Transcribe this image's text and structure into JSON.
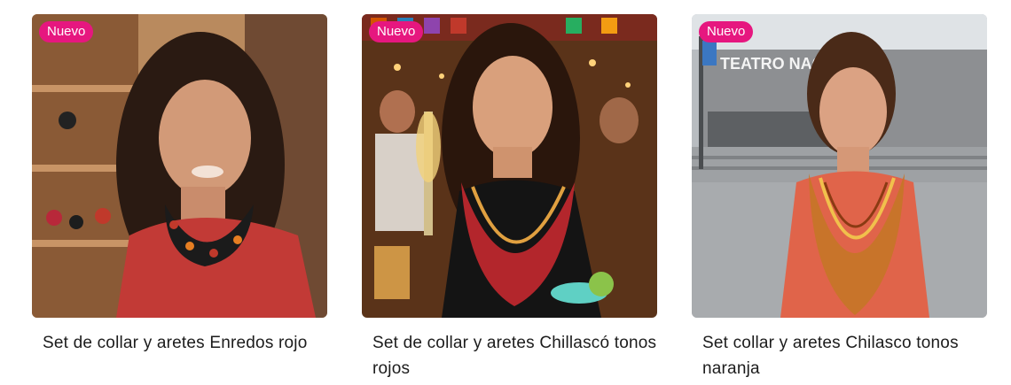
{
  "products": [
    {
      "badge": "Nuevo",
      "title": "Set de collar y aretes Enredos rojo"
    },
    {
      "badge": "Nuevo",
      "title": "Set de collar y aretes Chillascó tonos rojos"
    },
    {
      "badge": "Nuevo",
      "title": "Set collar y aretes Chilasco tonos naranja",
      "photo_sign": "TEATRO NACIONAL"
    }
  ]
}
